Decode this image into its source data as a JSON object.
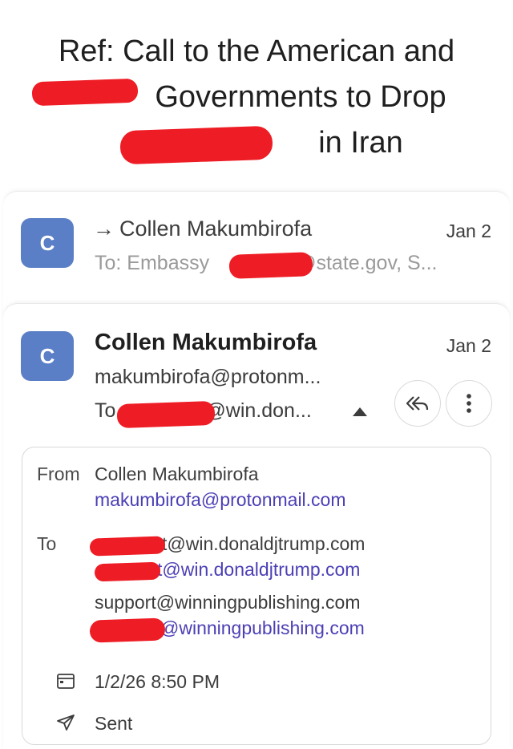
{
  "subject": {
    "line1": "Ref: Call to the American and",
    "line2": "Governments to Drop",
    "line3": "in Iran"
  },
  "collapsed_message": {
    "avatar_letter": "C",
    "from_arrow": "→",
    "from_name": "Collen Makumbirofa",
    "date": "Jan 2",
    "to_prefix": "To: Embassy",
    "to_suffix": "@state.gov, S..."
  },
  "expanded_message": {
    "avatar_letter": "C",
    "sender_name": "Collen Makumbirofa",
    "date": "Jan 2",
    "sender_email": "makumbirofa@protonm...",
    "to_prefix": "To",
    "to_suffix": "@win.don...",
    "icons": {
      "reply_all": "reply-all-icon",
      "more": "more-vert-icon",
      "expand": "caret-up-icon"
    }
  },
  "details": {
    "from_label": "From",
    "from_name": "Collen Makumbirofa",
    "from_email": "makumbirofa@protonmail.com",
    "to_label": "To",
    "recipients": [
      "t@win.donaldjtrump.com",
      "t@win.donaldjtrump.com",
      "support@winningpublishing.com",
      "@winningpublishing.com"
    ],
    "datetime": "1/2/26 8:50 PM",
    "status": "Sent",
    "icons": {
      "date": "calendar-icon",
      "status": "send-icon"
    }
  },
  "colors": {
    "avatar": "#5b7fc6",
    "link": "#4b3fb5",
    "redaction": "#ee1c24"
  }
}
